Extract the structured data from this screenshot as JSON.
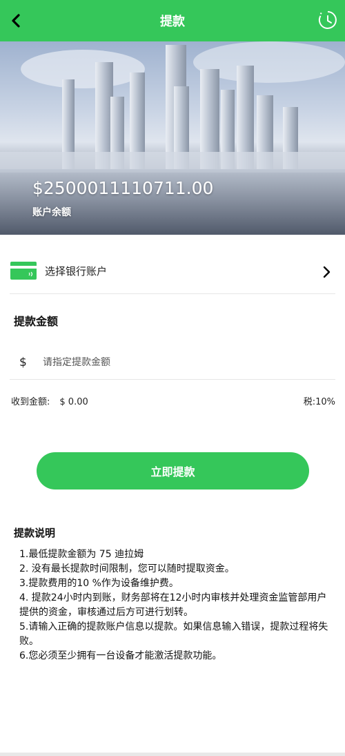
{
  "header": {
    "title": "提款",
    "back_icon": "chevron-left-icon",
    "history_icon": "clock-history-icon",
    "color": "#35c75a"
  },
  "banner": {
    "balance": "$2500011110711.00",
    "balance_label": "账户余额"
  },
  "bank": {
    "label": "选择银行账户",
    "card_icon": "bank-card-icon",
    "arrow_icon": "chevron-right-icon"
  },
  "amount": {
    "title": "提款金额",
    "currency": "$",
    "placeholder": "请指定提款金额"
  },
  "summary": {
    "receive_label": "收到金额:",
    "receive_value": "$ 0.00",
    "tax_label": "税:",
    "tax_value": "10%"
  },
  "submit_label": "立即提款",
  "notes": {
    "title": "提款说明",
    "items": [
      "1.最低提款金额为 75 迪拉姆",
      "2. 没有最长提款时间限制，您可以随时提取资金。",
      "3.提款费用的10 %作为设备维护费。",
      "4. 提款24小时内到账，财务部将在12小时内审核并处理资金监管部用户提供的资金，审核通过后方可进行划转。",
      "5.请输入正确的提款账户信息以提款。如果信息输入错误，提款过程将失败。",
      "6.您必须至少拥有一台设备才能激活提款功能。"
    ]
  }
}
